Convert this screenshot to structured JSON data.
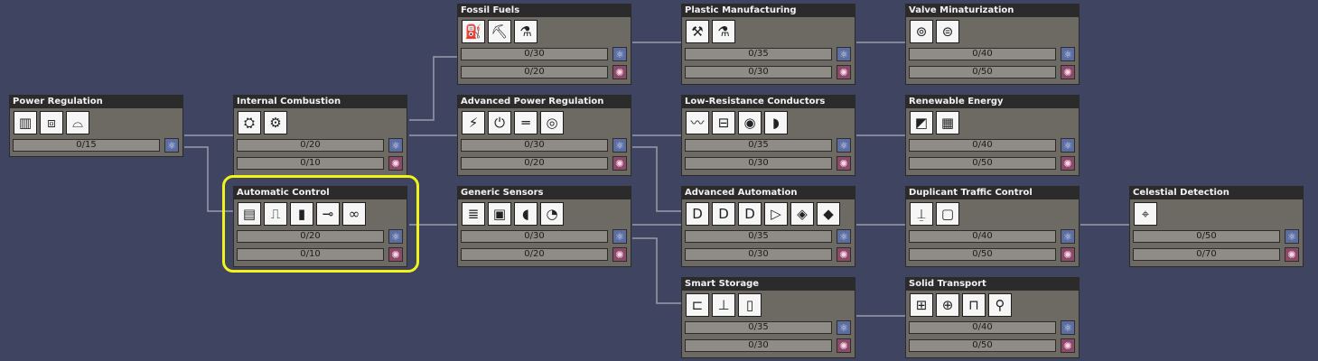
{
  "colors": {
    "background": "#3f4461",
    "card": "#6d6a63",
    "title_bar": "#2b2b2b",
    "highlight": "#f3f31c",
    "research_blue": "#5c6da0",
    "research_pink": "#8a4a69"
  },
  "nodes": {
    "power_regulation": {
      "title": "Power Regulation",
      "icons": [
        "battery-icon",
        "power-transformer-icon",
        "wire-bridge-icon"
      ],
      "bars": [
        {
          "value": "0/15",
          "type": "blue"
        }
      ]
    },
    "internal_combustion": {
      "title": "Internal Combustion",
      "icons": [
        "coal-generator-icon",
        "hydrogen-generator-icon"
      ],
      "bars": [
        {
          "value": "0/20",
          "type": "blue"
        },
        {
          "value": "0/10",
          "type": "pink"
        }
      ]
    },
    "automatic_control": {
      "title": "Automatic Control",
      "icons": [
        "automation-panel-icon",
        "smart-switch-icon",
        "signal-sensor-icon",
        "signal-wire-icon",
        "signal-bridge-icon"
      ],
      "bars": [
        {
          "value": "0/20",
          "type": "blue"
        },
        {
          "value": "0/10",
          "type": "pink"
        }
      ]
    },
    "fossil_fuels": {
      "title": "Fossil Fuels",
      "icons": [
        "oil-well-icon",
        "petroleum-generator-icon",
        "oil-refinery-icon"
      ],
      "bars": [
        {
          "value": "0/30",
          "type": "blue"
        },
        {
          "value": "0/20",
          "type": "pink"
        }
      ]
    },
    "advanced_power_regulation": {
      "title": "Advanced Power Regulation",
      "icons": [
        "large-transformer-icon",
        "power-shutoff-icon",
        "heavy-wire-icon",
        "steam-turbine-icon"
      ],
      "bars": [
        {
          "value": "0/30",
          "type": "blue"
        },
        {
          "value": "0/20",
          "type": "pink"
        }
      ]
    },
    "generic_sensors": {
      "title": "Generic Sensors",
      "icons": [
        "element-sensor-icon",
        "gas-pressure-sensor-icon",
        "weight-plate-icon",
        "timer-sensor-icon"
      ],
      "bars": [
        {
          "value": "0/30",
          "type": "blue"
        },
        {
          "value": "0/20",
          "type": "pink"
        }
      ]
    },
    "plastic_manufacturing": {
      "title": "Plastic Manufacturing",
      "icons": [
        "polymer-press-icon",
        "oil-distiller-icon"
      ],
      "bars": [
        {
          "value": "0/35",
          "type": "blue"
        },
        {
          "value": "0/30",
          "type": "pink"
        }
      ]
    },
    "low_resistance_conductors": {
      "title": "Low-Resistance Conductors",
      "icons": [
        "conductive-wire-icon",
        "conductive-bridge-icon",
        "battery-smart-icon",
        "jumbo-battery-icon"
      ],
      "bars": [
        {
          "value": "0/35",
          "type": "blue"
        },
        {
          "value": "0/30",
          "type": "pink"
        }
      ]
    },
    "advanced_automation": {
      "title": "Advanced Automation",
      "icons": [
        "and-gate-icon",
        "or-gate-icon",
        "xor-gate-icon",
        "buffer-gate-icon",
        "not-gate-icon",
        "filter-gate-icon"
      ],
      "bars": [
        {
          "value": "0/35",
          "type": "blue"
        },
        {
          "value": "0/30",
          "type": "pink"
        }
      ]
    },
    "smart_storage": {
      "title": "Smart Storage",
      "icons": [
        "conveyor-meter-icon",
        "liquid-shutoff-icon",
        "smart-storage-bin-icon"
      ],
      "bars": [
        {
          "value": "0/35",
          "type": "blue"
        },
        {
          "value": "0/30",
          "type": "pink"
        }
      ]
    },
    "valve_miniaturization": {
      "title": "Valve Minaturization",
      "icons": [
        "mini-pump-icon",
        "mini-gas-pump-icon"
      ],
      "bars": [
        {
          "value": "0/40",
          "type": "blue"
        },
        {
          "value": "0/50",
          "type": "pink"
        }
      ]
    },
    "renewable_energy": {
      "title": "Renewable Energy",
      "icons": [
        "solar-panel-icon",
        "battery-bank-icon"
      ],
      "bars": [
        {
          "value": "0/40",
          "type": "blue"
        },
        {
          "value": "0/50",
          "type": "pink"
        }
      ]
    },
    "duplicant_traffic_control": {
      "title": "Duplicant Traffic Control",
      "icons": [
        "duplicant-checkpoint-icon",
        "door-control-icon"
      ],
      "bars": [
        {
          "value": "0/40",
          "type": "blue"
        },
        {
          "value": "0/50",
          "type": "pink"
        }
      ]
    },
    "solid_transport": {
      "title": "Solid Transport",
      "icons": [
        "conveyor-loader-icon",
        "conveyor-receptacle-icon",
        "conveyor-chute-icon",
        "auto-sweeper-icon"
      ],
      "bars": [
        {
          "value": "0/40",
          "type": "blue"
        },
        {
          "value": "0/50",
          "type": "pink"
        }
      ]
    },
    "celestial_detection": {
      "title": "Celestial Detection",
      "icons": [
        "telescope-icon"
      ],
      "bars": [
        {
          "value": "0/50",
          "type": "blue"
        },
        {
          "value": "0/70",
          "type": "pink"
        }
      ]
    }
  }
}
